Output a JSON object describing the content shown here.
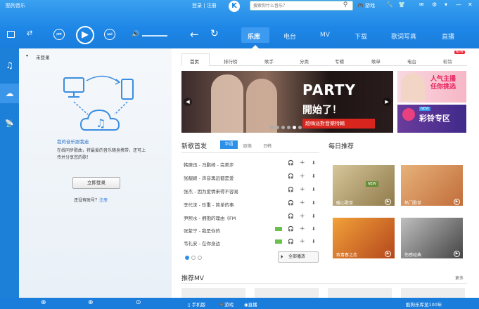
{
  "topbar": {
    "brand": "酷狗音乐",
    "login_link": "登录 | 注册",
    "logo_letter": "K",
    "search_placeholder": "搜索你什么音乐？",
    "game_label": "游戏",
    "nav_tabs": [
      "乐库",
      "电台",
      "MV",
      "下载",
      "歌词写真",
      "直播"
    ],
    "active_tab": "乐库"
  },
  "left_panel": {
    "section_title": "未登录",
    "desc_title": "我的音乐跟我走",
    "desc_body": "在线同步歌曲，将最爱的音乐随身携带，还可上传并分享您的歌！",
    "login_button": "立即登录",
    "no_account": "还没有账号？",
    "register_link": "注册"
  },
  "sub_tabs": [
    "首页",
    "排行榜",
    "歌手",
    "分类",
    "专辑",
    "歌单",
    "电台",
    "彩铃"
  ],
  "new_badge": "NEW",
  "banner": {
    "line1": "PARTY",
    "line2": "開始了！",
    "red_strip": "超嗨派對音樂特輯"
  },
  "side_ads": {
    "top": "人气主播\n任你挑选",
    "bottom_badge": "NEW",
    "bottom": "彩铃专区"
  },
  "new_songs": {
    "title": "新歌首发",
    "filters": [
      "华语",
      "欧美",
      "日韩"
    ],
    "songs": [
      "韩庚迅 - 冯鹏绮 - 完美步",
      "张靓颖 - 声音再远都是爱",
      "张杰 - 因为爱情来得不容易",
      "李代沫 - 珍重 - 简单的事",
      "尹熙水 - 拥抱的理由《FM",
      "张紫宁 - 我是你的",
      "韦礼安 - 在你身边"
    ],
    "play_all": "全部播放"
  },
  "daily": {
    "title": "每日推荐",
    "tiles": [
      "暖心歌单",
      "热门歌单",
      "致青春之恋",
      "伤感经典"
    ]
  },
  "mv": {
    "title": "推荐MV",
    "more": "更多"
  },
  "bottombar": {
    "phone": "手机版",
    "game": "游戏",
    "live": "直播",
    "right_text": "酷狗乐库至100年"
  }
}
